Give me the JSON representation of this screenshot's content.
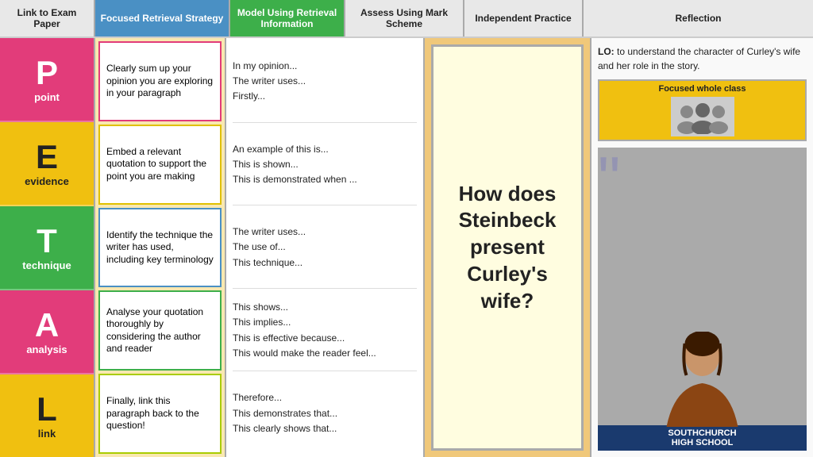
{
  "header": {
    "col1": "Link to Exam Paper",
    "col2": "Focused Retrieval Strategy",
    "col3": "Model Using Retrieval Information",
    "col4": "Assess Using Mark Scheme",
    "col5": "Independent Practice",
    "col6": "Reflection"
  },
  "petal": [
    {
      "letter": "P",
      "word": "point",
      "colorClass": "p-color"
    },
    {
      "letter": "E",
      "word": "evidence",
      "colorClass": "e-color"
    },
    {
      "letter": "T",
      "word": "technique",
      "colorClass": "t-color"
    },
    {
      "letter": "A",
      "word": "analysis",
      "colorClass": "a-color"
    },
    {
      "letter": "L",
      "word": "link",
      "colorClass": "l-color"
    }
  ],
  "descriptions": [
    {
      "text": "Clearly sum up your opinion you are exploring in your paragraph",
      "borderClass": "pink-border"
    },
    {
      "text": "Embed a relevant quotation to support the point you are making",
      "borderClass": "yellow-border"
    },
    {
      "text": "Identify the technique the writer has used, including key terminology",
      "borderClass": "blue-border"
    },
    {
      "text": "Analyse your quotation thoroughly by considering the author and reader",
      "borderClass": "green-border"
    },
    {
      "text": "Finally, link this paragraph back to the question!",
      "borderClass": "lime-border"
    }
  ],
  "starters": [
    [
      "In my opinion...",
      "The writer uses...",
      "Firstly..."
    ],
    [
      "An example of this is...",
      "This is shown...",
      "This is demonstrated when ..."
    ],
    [
      "The writer uses...",
      "The use of...",
      "This technique..."
    ],
    [
      "This shows...",
      "This implies...",
      "This is effective because...",
      "This would make the reader feel..."
    ],
    [
      "Therefore...",
      "This demonstrates that...",
      "This clearly shows that..."
    ]
  ],
  "question": {
    "text": "How does Steinbeck present Curley's wife?"
  },
  "reflection": {
    "lo_label": "LO:",
    "lo_text": "to understand the character of Curley's wife and her role in the story.",
    "focused_label": "Focused whole class",
    "school_name": "SOUTHCHURCH\nHIGH SCHOOL"
  }
}
